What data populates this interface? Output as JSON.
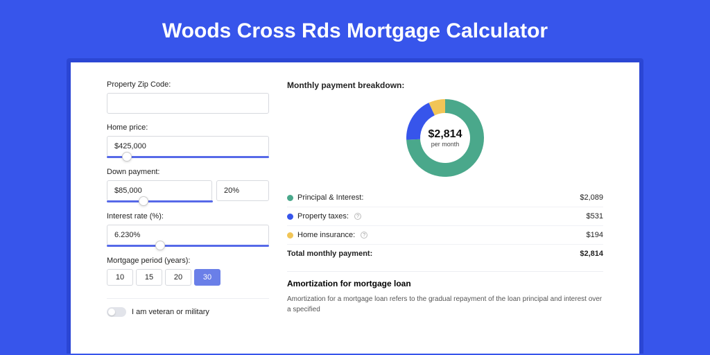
{
  "title": "Woods Cross Rds Mortgage Calculator",
  "left": {
    "zip_label": "Property Zip Code:",
    "zip_value": "",
    "home_price_label": "Home price:",
    "home_price_value": "$425,000",
    "down_label": "Down payment:",
    "down_amount": "$85,000",
    "down_percent": "20%",
    "rate_label": "Interest rate (%):",
    "rate_value": "6.230%",
    "period_label": "Mortgage period (years):",
    "periods": [
      "10",
      "15",
      "20",
      "30"
    ],
    "period_selected": 3,
    "veteran_label": "I am veteran or military"
  },
  "right": {
    "breakdown_title": "Monthly payment breakdown:",
    "center_amount": "$2,814",
    "center_sub": "per month",
    "items": [
      {
        "label": "Principal & Interest:",
        "value": "$2,089",
        "color": "#4aa88b",
        "info": false
      },
      {
        "label": "Property taxes:",
        "value": "$531",
        "color": "#3755eb",
        "info": true
      },
      {
        "label": "Home insurance:",
        "value": "$194",
        "color": "#f1c557",
        "info": true
      }
    ],
    "total_label": "Total monthly payment:",
    "total_value": "$2,814",
    "amort_title": "Amortization for mortgage loan",
    "amort_text": "Amortization for a mortgage loan refers to the gradual repayment of the loan principal and interest over a specified"
  },
  "chart_data": {
    "type": "pie",
    "title": "Monthly payment breakdown",
    "series": [
      {
        "name": "Principal & Interest",
        "value": 2089,
        "color": "#4aa88b"
      },
      {
        "name": "Property taxes",
        "value": 531,
        "color": "#3755eb"
      },
      {
        "name": "Home insurance",
        "value": 194,
        "color": "#f1c557"
      }
    ],
    "total": 2814
  }
}
